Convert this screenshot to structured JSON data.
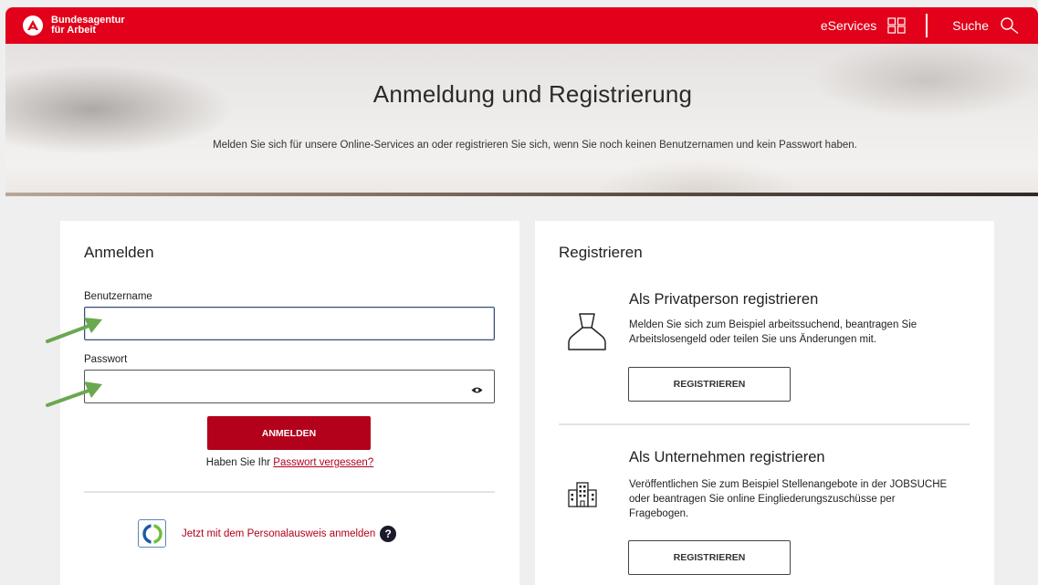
{
  "header": {
    "logo_line1": "Bundesagentur",
    "logo_line2": "für Arbeit",
    "eservices_label": "eServices",
    "search_label": "Suche",
    "brand_color": "#e2001a"
  },
  "hero": {
    "title": "Anmeldung und Registrierung",
    "subtitle": "Melden Sie sich für unsere Online-Services an oder registrieren Sie sich, wenn Sie noch keinen Benutzernamen und kein Passwort haben."
  },
  "login": {
    "title": "Anmelden",
    "username_label": "Benutzername",
    "username_value": "",
    "password_label": "Passwort",
    "password_value": "",
    "submit_label": "ANMELDEN",
    "forgot_prefix": "Haben Sie Ihr ",
    "forgot_link": "Passwort vergessen?",
    "id_card_link": "Jetzt mit dem Personalausweis anmelden",
    "help_glyph": "?"
  },
  "register": {
    "title": "Registrieren",
    "private": {
      "title": "Als Privatperson registrieren",
      "text": "Melden Sie sich zum Beispiel arbeitssuchend, beantragen Sie Arbeitslosengeld oder teilen Sie uns Änderungen mit.",
      "button_label": "REGISTRIEREN",
      "icon": "person-icon"
    },
    "company": {
      "title": "Als Unternehmen registrieren",
      "text": "Veröffentlichen Sie zum Beispiel Stellenangebote in der JOBSUCHE oder beantragen Sie online Eingliederungszuschüsse per Fragebogen.",
      "button_label": "REGISTRIEREN",
      "icon": "building-icon"
    }
  },
  "colors": {
    "accent_red": "#b3001b",
    "annotation_arrow": "#6aa84f"
  }
}
